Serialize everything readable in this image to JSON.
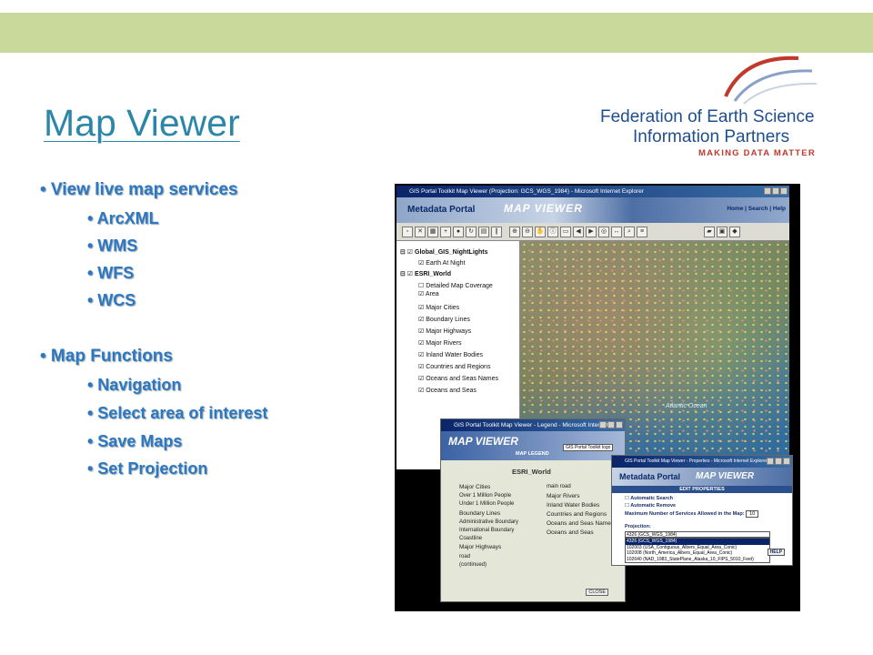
{
  "slide": {
    "title": "Map Viewer",
    "logo": {
      "line1": "Federation of Earth Science",
      "line2": "Information Partners",
      "tagline": "MAKING DATA MATTER"
    },
    "bullets": [
      {
        "level": 1,
        "text": "• View live map services"
      },
      {
        "level": 2,
        "text": "• ArcXML"
      },
      {
        "level": 2,
        "text": "• WMS"
      },
      {
        "level": 2,
        "text": "• WFS"
      },
      {
        "level": 2,
        "text": "• WCS"
      },
      {
        "level": 1,
        "text": "• Map Functions"
      },
      {
        "level": 2,
        "text": "• Navigation"
      },
      {
        "level": 2,
        "text": "• Select area of interest"
      },
      {
        "level": 2,
        "text": "• Save Maps"
      },
      {
        "level": 2,
        "text": "• Set Projection"
      }
    ]
  },
  "screenshot": {
    "browser_title": "GIS Portal Toolkit Map Viewer (Projection: GCS_WGS_1984) - Microsoft Internet Explorer",
    "banner_logo": "Metadata Portal",
    "banner_title": "MAP VIEWER",
    "banner_links": "Home | Search | Help",
    "toc": [
      "Global_GIS_NightLights",
      "Earth At Night",
      "ESRI_World",
      "Detailed Map Coverage",
      "Area",
      "Major Cities",
      "Boundary Lines",
      "Major Highways",
      "Major Rivers",
      "Inland Water Bodies",
      "Countries and Regions",
      "Oceans and Seas Names",
      "Oceans and Seas"
    ],
    "map_label": "Atlantic Ocean",
    "legend": {
      "title": "GIS Portal Toolkit Map Viewer - Legend - Microsoft Internet ...",
      "banner": "MAP VIEWER",
      "subtitle": "MAP LEGEND",
      "toolkit_logo": "GIS Portal Toolkit logo",
      "layer": "ESRI_World",
      "left_items": [
        "Major Cities",
        "Over 1 Million People",
        "Under 1 Million People",
        "Boundary Lines",
        "Administrative Boundary",
        "International Boundary",
        "Coastline",
        "Major Highways",
        "road",
        "(continued)"
      ],
      "right_items": [
        "main road",
        "Major Rivers",
        "Inland Water Bodies",
        "Countries and Regions",
        "Oceans and Seas Names",
        "Oceans and Seas"
      ],
      "close": "CLOSE"
    },
    "properties": {
      "title": "GIS Portal Toolkit Map Viewer - Properties - Microsoft Internet Explorer",
      "banner_logo": "Metadata Portal",
      "banner_title": "MAP VIEWER",
      "subtitle": "EDIT PROPERTIES",
      "auto_search": "Automatic Search",
      "auto_remove": "Automatic Remove",
      "max_services": "Maximum Number of Services Allowed in the Map:",
      "max_value": "10",
      "projection_label": "Projection:",
      "projection_selected": "4326 (GCS_WGS_1984)",
      "projection_options": [
        "4326 (GCS_WGS_1984)",
        "102003 (USA_Contiguous_Albers_Equal_Area_Conic)",
        "102008 (North_America_Albers_Equal_Area_Conic)",
        "102640 (NAD_1983_StatePlane_Alaska_10_FIPS_5010_Feet)"
      ],
      "help": "HELP"
    }
  },
  "colors": {
    "top_band": "#c9d99c",
    "title": "#2b86a8",
    "bullet_text": "#2c78c2",
    "logo_blue": "#1f4e8c",
    "logo_red": "#c0392b"
  }
}
